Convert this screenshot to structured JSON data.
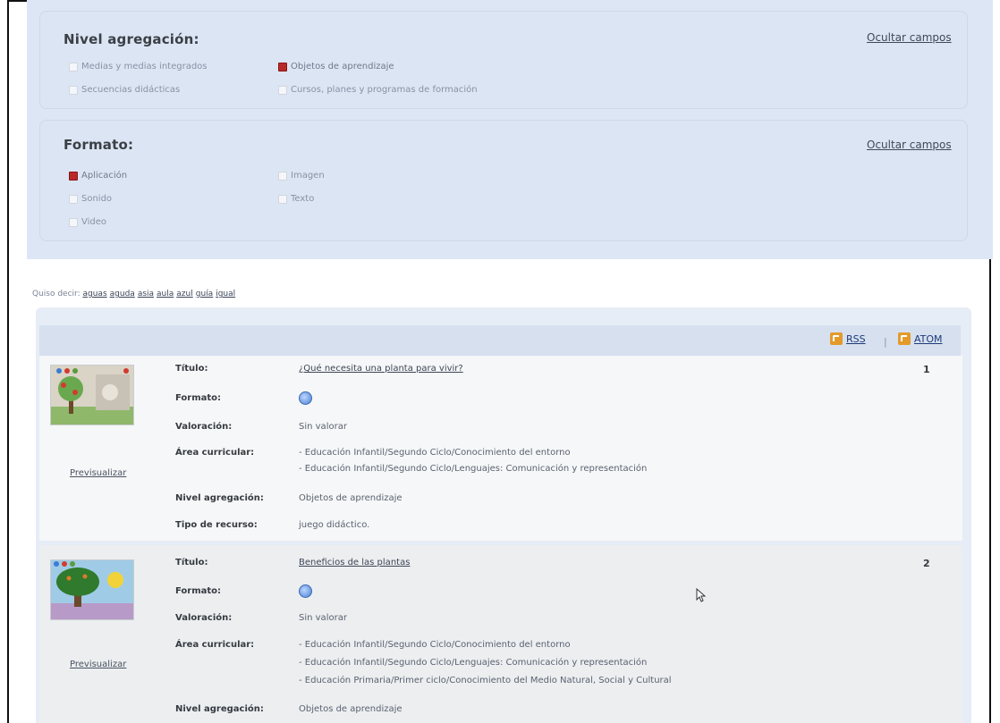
{
  "nivel_agregacion": {
    "title": "Nivel agregación:",
    "hide_label": "Ocultar campos",
    "options": [
      {
        "label": "Medias y medias integrados",
        "checked": false
      },
      {
        "label": "Objetos de aprendizaje",
        "checked": true
      },
      {
        "label": "Secuencias didácticas",
        "checked": false
      },
      {
        "label": "Cursos, planes y programas de formación",
        "checked": false
      }
    ]
  },
  "formato": {
    "title": "Formato:",
    "hide_label": "Ocultar campos",
    "options": [
      {
        "label": "Aplicación",
        "checked": true
      },
      {
        "label": "Imagen",
        "checked": false
      },
      {
        "label": "Sonido",
        "checked": false
      },
      {
        "label": "Texto",
        "checked": false
      },
      {
        "label": "Video",
        "checked": false
      }
    ]
  },
  "did_you_mean": {
    "prefix": "Quiso decir:",
    "words": [
      "aguas",
      "aguda",
      "asia",
      "aula",
      "azul",
      "guía",
      "igual"
    ]
  },
  "feeds": {
    "rss": "RSS",
    "separator": "|",
    "atom": "ATOM"
  },
  "labels": {
    "titulo": "Título:",
    "formato": "Formato:",
    "valoracion": "Valoración:",
    "area": "Área curricular:",
    "nivel": "Nivel agregación:",
    "tipo": "Tipo de recurso:",
    "preview": "Previsualizar"
  },
  "results": [
    {
      "number": "1",
      "title": "¿Qué necesita una planta para vivir?",
      "valoracion": "Sin valorar",
      "areas": [
        "- Educación Infantil/Segundo Ciclo/Conocimiento del entorno",
        "- Educación Infantil/Segundo Ciclo/Lenguajes: Comunicación y representación"
      ],
      "nivel": "Objetos de aprendizaje",
      "tipo": "juego didáctico."
    },
    {
      "number": "2",
      "title": "Beneficios de las plantas",
      "valoracion": "Sin valorar",
      "areas": [
        "- Educación Infantil/Segundo Ciclo/Conocimiento del entorno",
        "- Educación Infantil/Segundo Ciclo/Lenguajes: Comunicación y representación",
        "- Educación Primaria/Primer ciclo/Conocimiento del Medio Natural, Social y Cultural"
      ],
      "nivel": "Objetos de aprendizaje"
    }
  ],
  "colors": {
    "checked": "#b82a2a",
    "panel": "#dce5f3",
    "feed": "#e39a2b"
  }
}
